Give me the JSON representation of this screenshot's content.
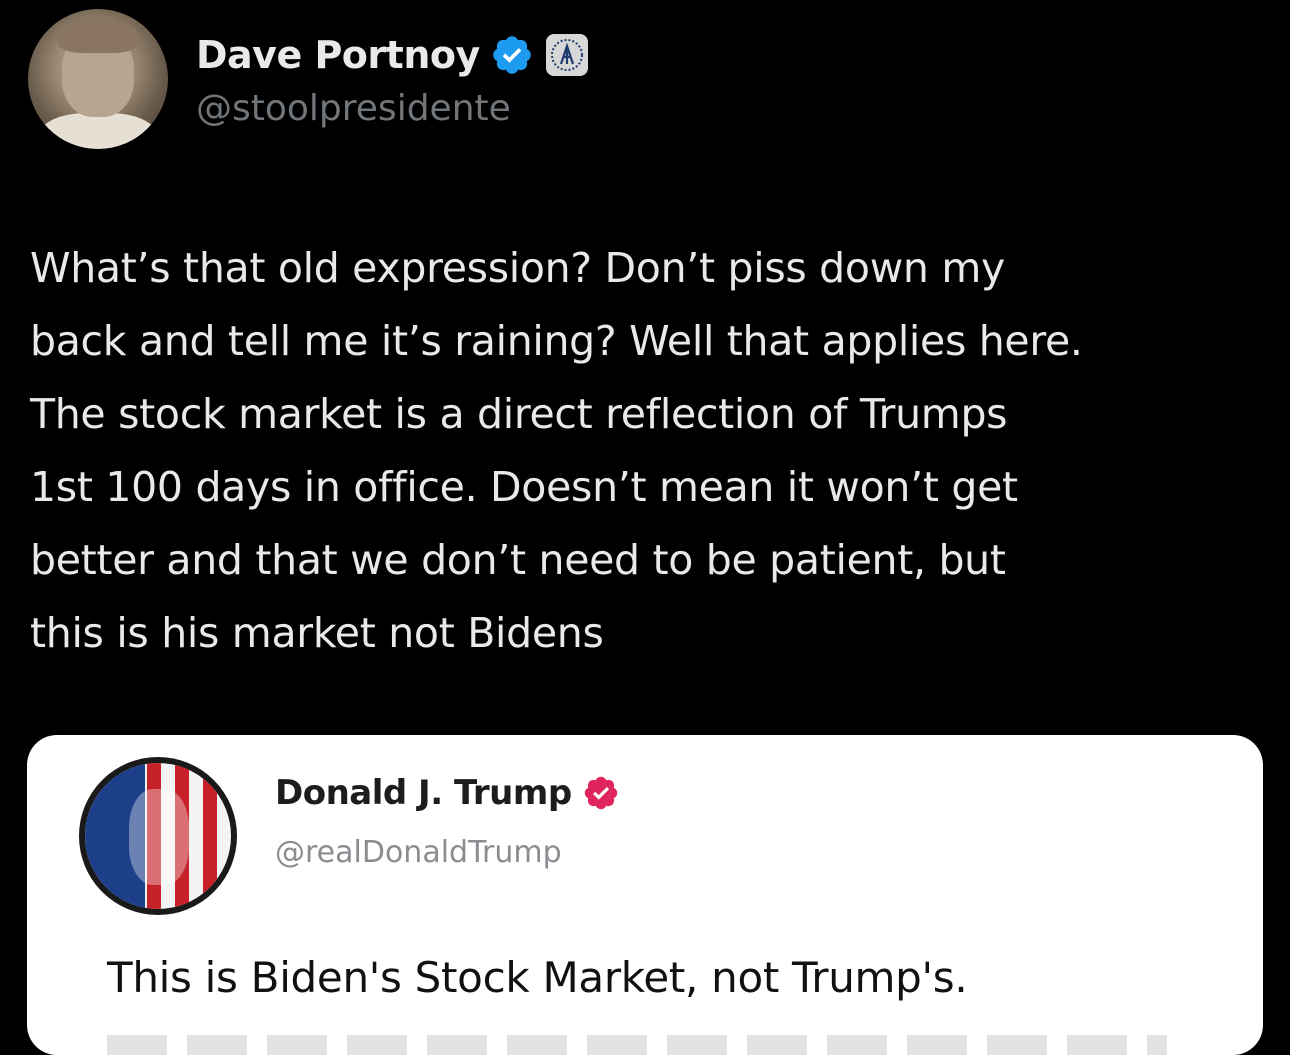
{
  "author": {
    "display_name": "Dave Portnoy",
    "handle": "@stoolpresidente"
  },
  "tweet": {
    "lines": [
      "What’s that old expression? Don’t piss down my",
      "back and tell me it’s raining? Well that applies here.",
      "The stock market is a direct reflection of Trumps",
      "1st 100 days in office. Doesn’t mean it won’t get",
      "better and that we don’t need to be patient, but",
      "this is his market not Bidens"
    ]
  },
  "quoted": {
    "display_name": "Donald J. Trump",
    "handle": "@realDonaldTrump",
    "text": "This is Biden's Stock Market, not Trump's."
  },
  "colors": {
    "background": "#000000",
    "verified_blue": "#1d9bf0",
    "quoted_badge": "#e0245e"
  },
  "icons": {
    "verified": "verified-badge-icon",
    "affiliate": "barstool-logo-icon",
    "quoted_verified": "verified-badge-icon"
  }
}
